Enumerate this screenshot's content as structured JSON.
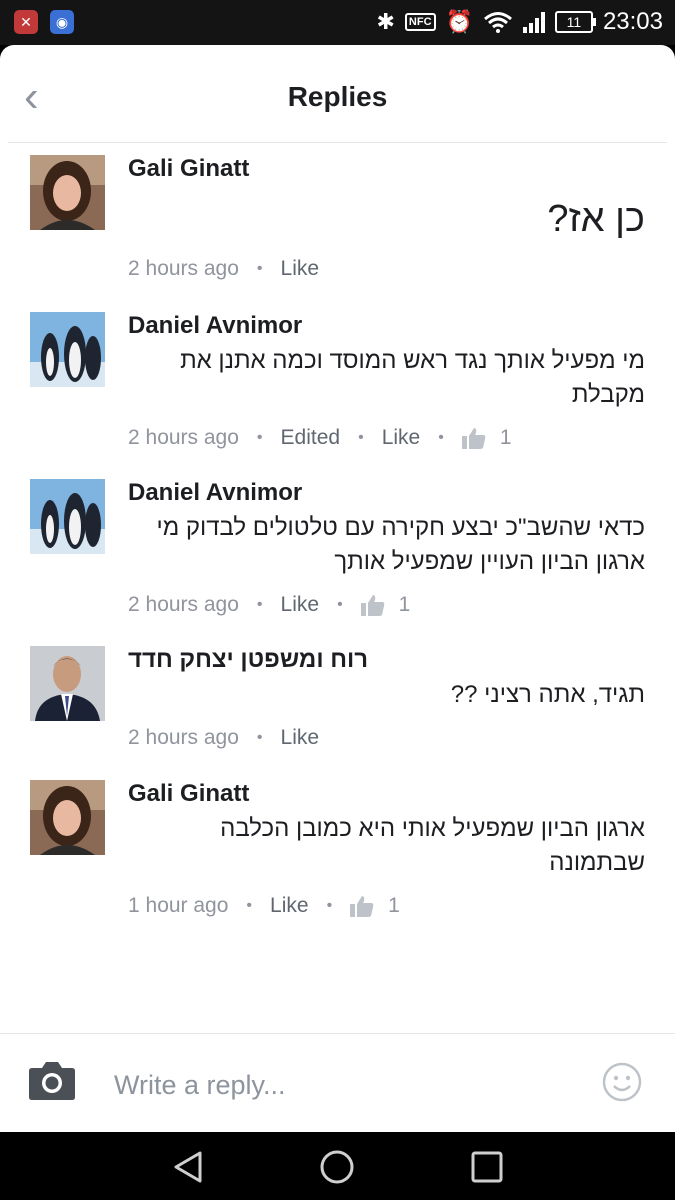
{
  "status_bar": {
    "time": "23:03",
    "battery": "11",
    "nfc": "NFC",
    "icons": [
      "app-icon",
      "wifi-app-icon",
      "bluetooth-icon",
      "nfc-icon",
      "alarm-icon",
      "wifi-icon",
      "signal-icon",
      "battery-icon"
    ]
  },
  "header": {
    "title": "Replies"
  },
  "comments": [
    {
      "author": "Gali Ginatt",
      "text": "כן אז?",
      "time": "2 hours ago",
      "actions": [
        "Like"
      ],
      "likes": ""
    },
    {
      "author": "Daniel Avnimor",
      "text": "מי מפעיל אותך נגד ראש המוסד וכמה אתנן את מקבלת",
      "time": "2 hours ago",
      "actions": [
        "Edited",
        "Like"
      ],
      "likes": "1"
    },
    {
      "author": "Daniel Avnimor",
      "text": "כדאי שהשב\"כ יבצע חקירה עם טלטולים לבדוק מי ארגון הביון העויין שמפעיל אותך",
      "time": "2 hours ago",
      "actions": [
        "Like"
      ],
      "likes": "1"
    },
    {
      "author": "רוח ומשפטן יצחק חדד",
      "text": "תגיד, אתה רציני ??",
      "time": "2 hours ago",
      "actions": [
        "Like"
      ],
      "likes": ""
    },
    {
      "author": "Gali Ginatt",
      "text": "ארגון הביון שמפעיל אותי היא כמובן הכלבה שבתמונה",
      "time": "1 hour ago",
      "actions": [
        "Like"
      ],
      "likes": "1"
    }
  ],
  "composer": {
    "placeholder": "Write a reply..."
  },
  "colors": {
    "text": "#1c1e21",
    "meta": "#90949c",
    "divider": "#e5e6ea",
    "icon": "#8d949e"
  }
}
